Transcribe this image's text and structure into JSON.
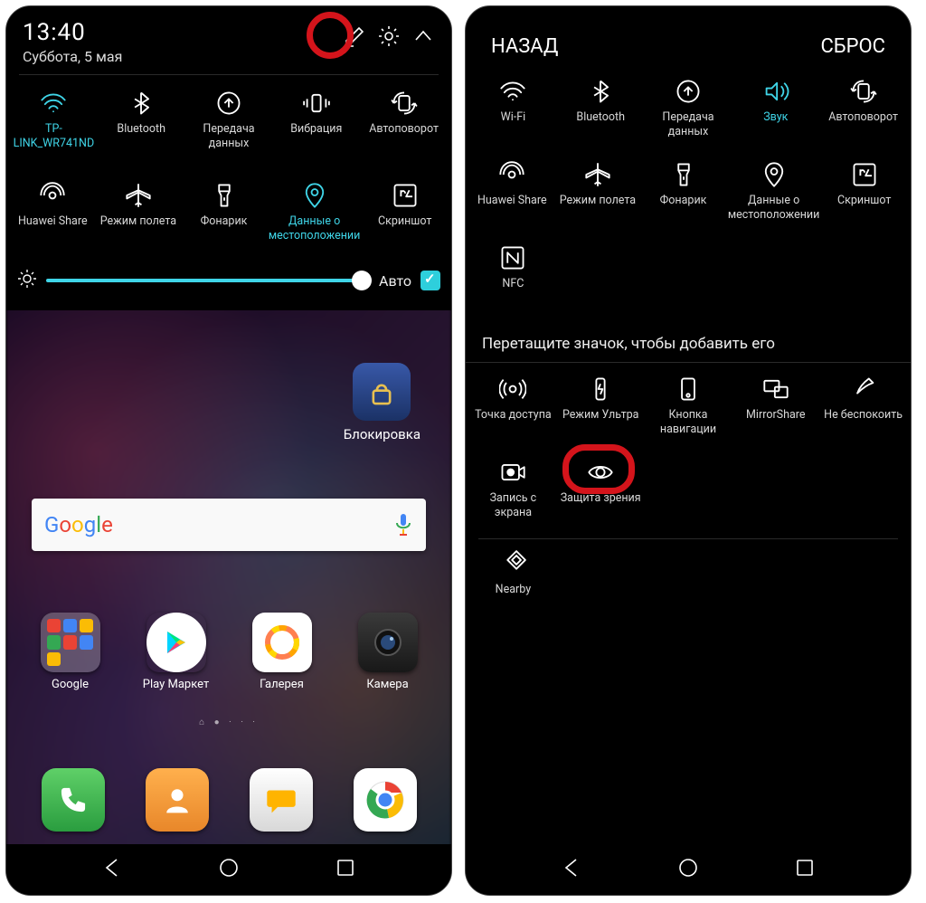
{
  "left": {
    "time": "13:40",
    "date": "Суббота, 5 мая",
    "tiles_row1": [
      {
        "id": "wifi",
        "label": "TP-LINK_WR741ND",
        "active": true
      },
      {
        "id": "bluetooth",
        "label": "Bluetooth",
        "active": false
      },
      {
        "id": "data",
        "label": "Передача данных",
        "active": false
      },
      {
        "id": "vibration",
        "label": "Вибрация",
        "active": false
      },
      {
        "id": "autorotate",
        "label": "Автоповорот",
        "active": false
      }
    ],
    "tiles_row2": [
      {
        "id": "huawei-share",
        "label": "Huawei Share",
        "active": false
      },
      {
        "id": "airplane",
        "label": "Режим полета",
        "active": false
      },
      {
        "id": "flashlight",
        "label": "Фонарик",
        "active": false
      },
      {
        "id": "location",
        "label": "Данные о местоположении",
        "active": true
      },
      {
        "id": "screenshot",
        "label": "Скриншот",
        "active": false
      }
    ],
    "auto_label": "Авто",
    "lock_widget_label": "Блокировка",
    "apps": [
      {
        "id": "google-folder",
        "label": "Google"
      },
      {
        "id": "playstore",
        "label": "Play Маркет"
      },
      {
        "id": "gallery",
        "label": "Галерея"
      },
      {
        "id": "camera",
        "label": "Камера"
      }
    ]
  },
  "right": {
    "back_label": "НАЗАД",
    "reset_label": "СБРОС",
    "tiles_row1": [
      {
        "id": "wifi",
        "label": "Wi-Fi",
        "active": false
      },
      {
        "id": "bluetooth",
        "label": "Bluetooth",
        "active": false
      },
      {
        "id": "data",
        "label": "Передача данных",
        "active": false
      },
      {
        "id": "sound",
        "label": "Звук",
        "active": true
      },
      {
        "id": "autorotate",
        "label": "Автоповорот",
        "active": false
      }
    ],
    "tiles_row2": [
      {
        "id": "huawei-share",
        "label": "Huawei Share",
        "active": false
      },
      {
        "id": "airplane",
        "label": "Режим полета",
        "active": false
      },
      {
        "id": "flashlight",
        "label": "Фонарик",
        "active": false
      },
      {
        "id": "location",
        "label": "Данные о местоположении",
        "active": false
      },
      {
        "id": "screenshot",
        "label": "Скриншот",
        "active": false
      }
    ],
    "tiles_row3": [
      {
        "id": "nfc",
        "label": "NFC",
        "active": false
      }
    ],
    "hint": "Перетащите значок, чтобы добавить его",
    "extra_row1": [
      {
        "id": "hotspot",
        "label": "Точка доступа"
      },
      {
        "id": "ultra",
        "label": "Режим Ультра"
      },
      {
        "id": "nav-key",
        "label": "Кнопка навигации"
      },
      {
        "id": "mirrorshare",
        "label": "MirrorShare"
      },
      {
        "id": "dnd",
        "label": "Не беспокоить"
      }
    ],
    "extra_row2": [
      {
        "id": "screen-record",
        "label": "Запись с экрана"
      },
      {
        "id": "eye-comfort",
        "label": "Защита зрения"
      }
    ],
    "extra_row3": [
      {
        "id": "nearby",
        "label": "Nearby"
      }
    ]
  }
}
